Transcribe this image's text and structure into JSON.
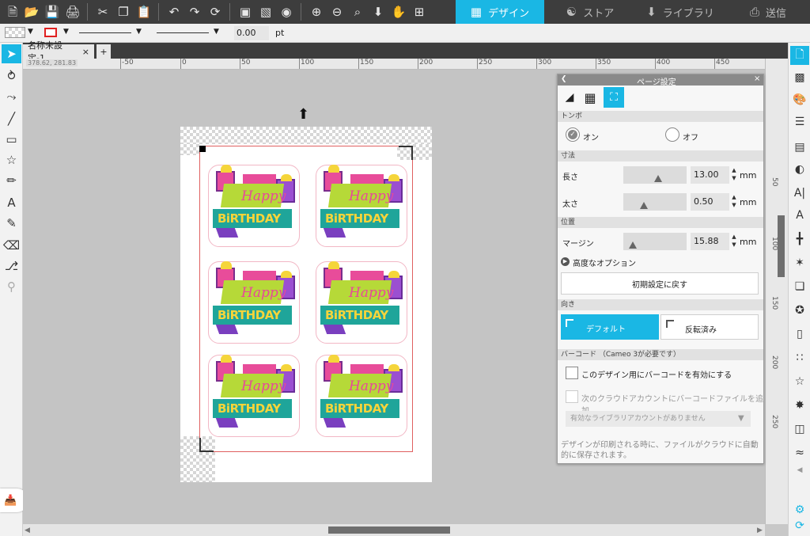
{
  "toolbar": {
    "icons": [
      "new-icon",
      "open-icon",
      "save-icon",
      "print-icon",
      "cut-icon",
      "copy-icon",
      "paste-icon",
      "undo-icon",
      "redo-icon",
      "refresh-icon",
      "group-icon",
      "ungroup-icon",
      "select-all-icon",
      "zoom-in-icon",
      "zoom-out-icon",
      "zoom-selection-icon",
      "pan-down-icon",
      "hand-icon",
      "fit-page-icon"
    ]
  },
  "modes": [
    {
      "label": "デザイン",
      "icon": "design-grid-icon",
      "active": true
    },
    {
      "label": "ストア",
      "icon": "store-icon",
      "active": false
    },
    {
      "label": "ライブラリ",
      "icon": "library-icon",
      "active": false
    },
    {
      "label": "送信",
      "icon": "send-icon",
      "active": false
    }
  ],
  "props": {
    "line_width_value": "0.00",
    "line_width_unit": "pt"
  },
  "document": {
    "tab_label": "名称未設定-1",
    "tab_close": "×",
    "add_tab": "+",
    "cursor_coords": "378.62, 281.83"
  },
  "ruler": {
    "h_labels": [
      "-50",
      "0",
      "50",
      "100",
      "150",
      "200",
      "250",
      "300",
      "350",
      "400",
      "450"
    ],
    "v_labels": [
      "50",
      "100",
      "150",
      "200",
      "250"
    ]
  },
  "design": {
    "sticker_line1": "Happy",
    "sticker_line2": "BiRTHDAY",
    "count": 6
  },
  "panel": {
    "title": "ページ設定",
    "close": "×",
    "tabs": [
      "page-icon",
      "grid-icon",
      "registration-icon"
    ],
    "section_registration": "トンボ",
    "reg_on": "オン",
    "reg_off": "オフ",
    "section_size": "寸法",
    "length_label": "長さ",
    "length_value": "13.00",
    "length_unit": "mm",
    "length_fraction": 0.55,
    "thickness_label": "太さ",
    "thickness_value": "0.50",
    "thickness_unit": "mm",
    "thickness_fraction": 0.3,
    "section_position": "位置",
    "margin_label": "マージン",
    "margin_value": "15.88",
    "margin_unit": "mm",
    "margin_fraction": 0.1,
    "advanced": "高度なオプション",
    "reset": "初期設定に戻す",
    "section_orientation": "向き",
    "orientation_default": "デフォルト",
    "orientation_reversed": "反転済み",
    "section_barcode": "バーコード （Cameo 3が必要です）",
    "barcode_enable": "このデザイン用にバーコードを有効にする",
    "barcode_cloud": "次のクラウドアカウントにバーコードファイルを追加",
    "library_select": "有効なライブラリアカウントがありません",
    "footer_note": "デザインが印刷される時に、ファイルがクラウドに自動的に保存されます。"
  },
  "colors": {
    "accent": "#1ab7e4",
    "toolbar": "#3d3d3d",
    "reg_line": "#e06060"
  }
}
